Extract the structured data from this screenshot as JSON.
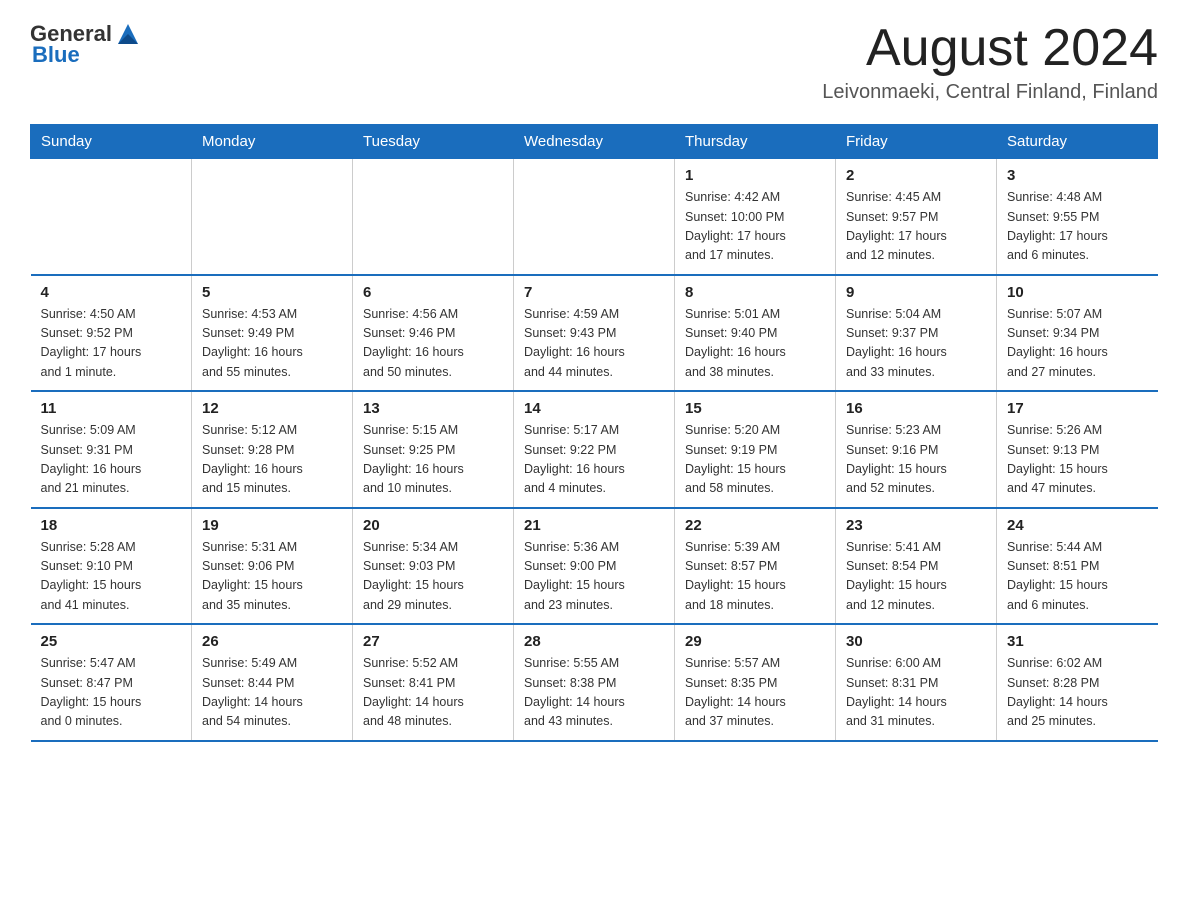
{
  "header": {
    "logo_general": "General",
    "logo_blue": "Blue",
    "month_title": "August 2024",
    "location": "Leivonmaeki, Central Finland, Finland"
  },
  "weekdays": [
    "Sunday",
    "Monday",
    "Tuesday",
    "Wednesday",
    "Thursday",
    "Friday",
    "Saturday"
  ],
  "weeks": [
    [
      {
        "day": "",
        "info": ""
      },
      {
        "day": "",
        "info": ""
      },
      {
        "day": "",
        "info": ""
      },
      {
        "day": "",
        "info": ""
      },
      {
        "day": "1",
        "info": "Sunrise: 4:42 AM\nSunset: 10:00 PM\nDaylight: 17 hours\nand 17 minutes."
      },
      {
        "day": "2",
        "info": "Sunrise: 4:45 AM\nSunset: 9:57 PM\nDaylight: 17 hours\nand 12 minutes."
      },
      {
        "day": "3",
        "info": "Sunrise: 4:48 AM\nSunset: 9:55 PM\nDaylight: 17 hours\nand 6 minutes."
      }
    ],
    [
      {
        "day": "4",
        "info": "Sunrise: 4:50 AM\nSunset: 9:52 PM\nDaylight: 17 hours\nand 1 minute."
      },
      {
        "day": "5",
        "info": "Sunrise: 4:53 AM\nSunset: 9:49 PM\nDaylight: 16 hours\nand 55 minutes."
      },
      {
        "day": "6",
        "info": "Sunrise: 4:56 AM\nSunset: 9:46 PM\nDaylight: 16 hours\nand 50 minutes."
      },
      {
        "day": "7",
        "info": "Sunrise: 4:59 AM\nSunset: 9:43 PM\nDaylight: 16 hours\nand 44 minutes."
      },
      {
        "day": "8",
        "info": "Sunrise: 5:01 AM\nSunset: 9:40 PM\nDaylight: 16 hours\nand 38 minutes."
      },
      {
        "day": "9",
        "info": "Sunrise: 5:04 AM\nSunset: 9:37 PM\nDaylight: 16 hours\nand 33 minutes."
      },
      {
        "day": "10",
        "info": "Sunrise: 5:07 AM\nSunset: 9:34 PM\nDaylight: 16 hours\nand 27 minutes."
      }
    ],
    [
      {
        "day": "11",
        "info": "Sunrise: 5:09 AM\nSunset: 9:31 PM\nDaylight: 16 hours\nand 21 minutes."
      },
      {
        "day": "12",
        "info": "Sunrise: 5:12 AM\nSunset: 9:28 PM\nDaylight: 16 hours\nand 15 minutes."
      },
      {
        "day": "13",
        "info": "Sunrise: 5:15 AM\nSunset: 9:25 PM\nDaylight: 16 hours\nand 10 minutes."
      },
      {
        "day": "14",
        "info": "Sunrise: 5:17 AM\nSunset: 9:22 PM\nDaylight: 16 hours\nand 4 minutes."
      },
      {
        "day": "15",
        "info": "Sunrise: 5:20 AM\nSunset: 9:19 PM\nDaylight: 15 hours\nand 58 minutes."
      },
      {
        "day": "16",
        "info": "Sunrise: 5:23 AM\nSunset: 9:16 PM\nDaylight: 15 hours\nand 52 minutes."
      },
      {
        "day": "17",
        "info": "Sunrise: 5:26 AM\nSunset: 9:13 PM\nDaylight: 15 hours\nand 47 minutes."
      }
    ],
    [
      {
        "day": "18",
        "info": "Sunrise: 5:28 AM\nSunset: 9:10 PM\nDaylight: 15 hours\nand 41 minutes."
      },
      {
        "day": "19",
        "info": "Sunrise: 5:31 AM\nSunset: 9:06 PM\nDaylight: 15 hours\nand 35 minutes."
      },
      {
        "day": "20",
        "info": "Sunrise: 5:34 AM\nSunset: 9:03 PM\nDaylight: 15 hours\nand 29 minutes."
      },
      {
        "day": "21",
        "info": "Sunrise: 5:36 AM\nSunset: 9:00 PM\nDaylight: 15 hours\nand 23 minutes."
      },
      {
        "day": "22",
        "info": "Sunrise: 5:39 AM\nSunset: 8:57 PM\nDaylight: 15 hours\nand 18 minutes."
      },
      {
        "day": "23",
        "info": "Sunrise: 5:41 AM\nSunset: 8:54 PM\nDaylight: 15 hours\nand 12 minutes."
      },
      {
        "day": "24",
        "info": "Sunrise: 5:44 AM\nSunset: 8:51 PM\nDaylight: 15 hours\nand 6 minutes."
      }
    ],
    [
      {
        "day": "25",
        "info": "Sunrise: 5:47 AM\nSunset: 8:47 PM\nDaylight: 15 hours\nand 0 minutes."
      },
      {
        "day": "26",
        "info": "Sunrise: 5:49 AM\nSunset: 8:44 PM\nDaylight: 14 hours\nand 54 minutes."
      },
      {
        "day": "27",
        "info": "Sunrise: 5:52 AM\nSunset: 8:41 PM\nDaylight: 14 hours\nand 48 minutes."
      },
      {
        "day": "28",
        "info": "Sunrise: 5:55 AM\nSunset: 8:38 PM\nDaylight: 14 hours\nand 43 minutes."
      },
      {
        "day": "29",
        "info": "Sunrise: 5:57 AM\nSunset: 8:35 PM\nDaylight: 14 hours\nand 37 minutes."
      },
      {
        "day": "30",
        "info": "Sunrise: 6:00 AM\nSunset: 8:31 PM\nDaylight: 14 hours\nand 31 minutes."
      },
      {
        "day": "31",
        "info": "Sunrise: 6:02 AM\nSunset: 8:28 PM\nDaylight: 14 hours\nand 25 minutes."
      }
    ]
  ]
}
